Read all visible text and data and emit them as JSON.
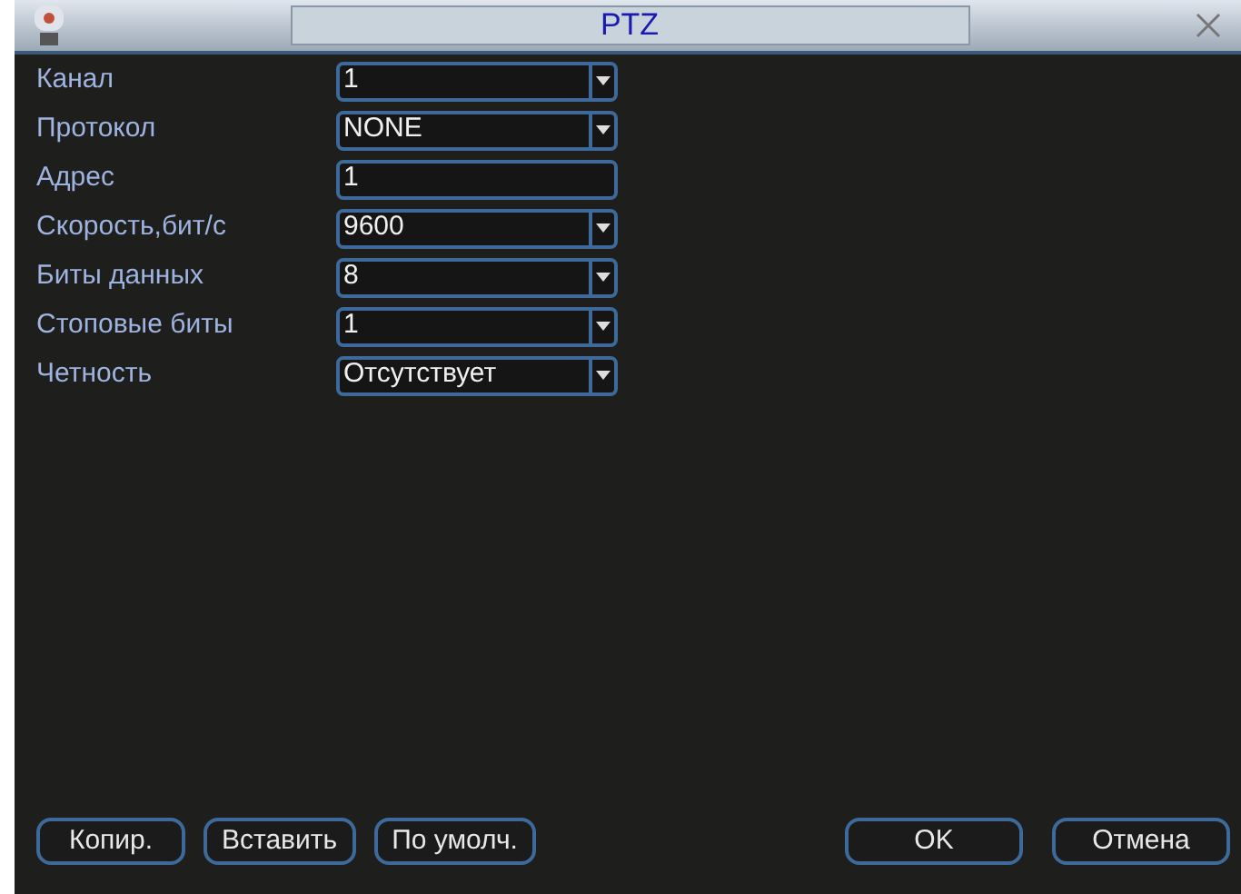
{
  "window": {
    "title": "PTZ"
  },
  "fields": [
    {
      "label": "Канал",
      "value": "1",
      "kind": "dropdown"
    },
    {
      "label": "Протокол",
      "value": "NONE",
      "kind": "dropdown"
    },
    {
      "label": "Адрес",
      "value": "1",
      "kind": "text"
    },
    {
      "label": "Скорость,бит/с",
      "value": "9600",
      "kind": "dropdown"
    },
    {
      "label": "Биты данных",
      "value": "8",
      "kind": "dropdown"
    },
    {
      "label": "Стоповые биты",
      "value": "1",
      "kind": "dropdown"
    },
    {
      "label": "Четность",
      "value": "Отсутствует",
      "kind": "dropdown"
    }
  ],
  "edit_buttons": [
    "Копир.",
    "Вставить",
    "По умолч."
  ],
  "dialog_buttons": [
    "OK",
    "Отмена"
  ]
}
